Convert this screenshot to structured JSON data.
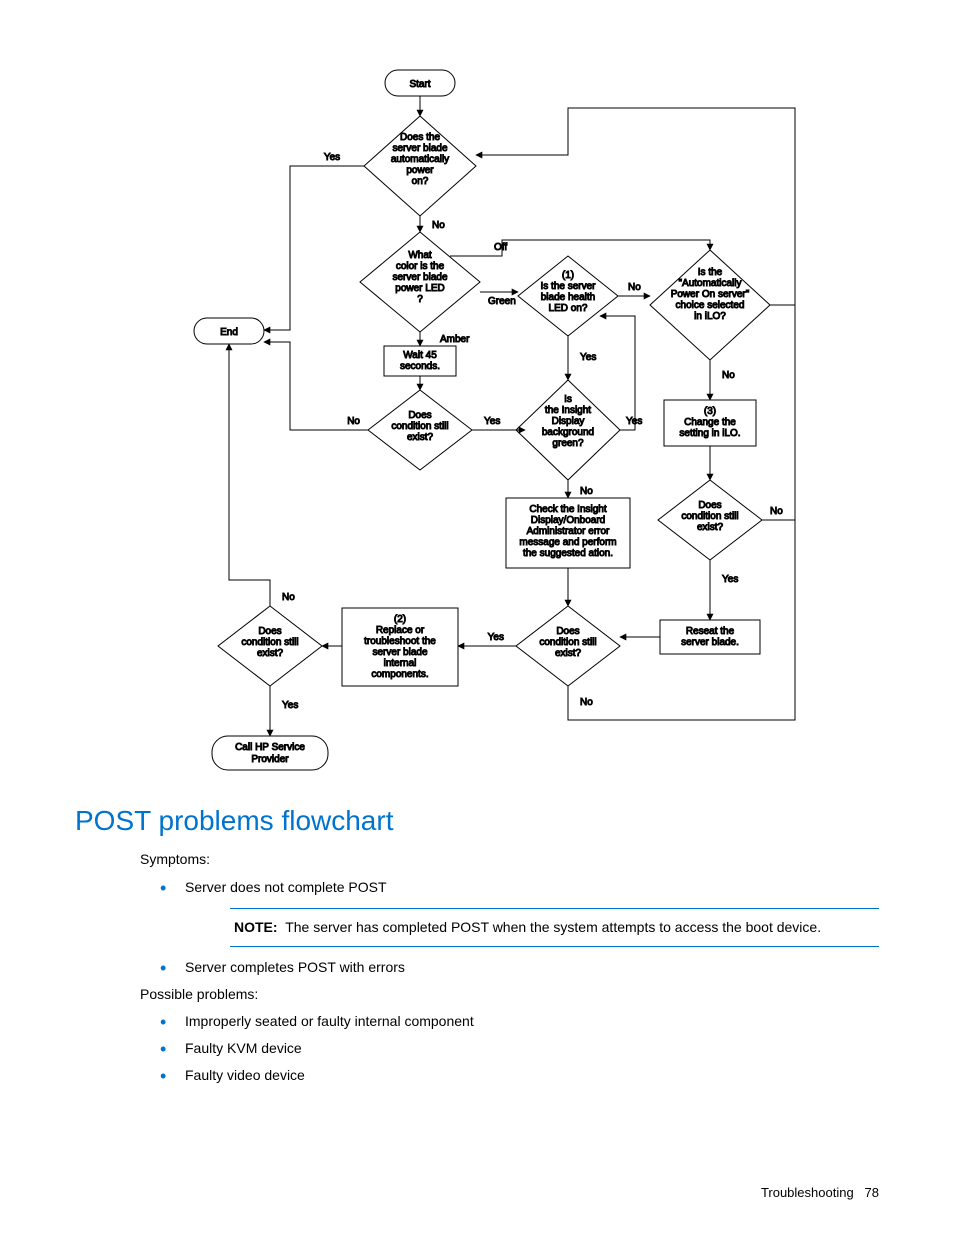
{
  "chart_data": {
    "type": "flowchart",
    "nodes": [
      {
        "id": "start",
        "kind": "terminator",
        "text": "Start"
      },
      {
        "id": "d1",
        "kind": "decision",
        "text": "Does the server blade automatically power on?"
      },
      {
        "id": "d2",
        "kind": "decision",
        "text": "What color is the server blade power LED ?"
      },
      {
        "id": "p_wait",
        "kind": "process",
        "text": "Wait 45 seconds."
      },
      {
        "id": "d_cond1",
        "kind": "decision",
        "text": "Does condition still exist?"
      },
      {
        "id": "end",
        "kind": "terminator",
        "text": "End"
      },
      {
        "id": "d_health",
        "kind": "decision",
        "text": "(1) Is the server blade health LED on?"
      },
      {
        "id": "d_ilo",
        "kind": "decision",
        "text": "Is the \"Automatically Power On server\" choice selected in iLO?"
      },
      {
        "id": "p_change",
        "kind": "process",
        "text": "(3) Change the setting in iLO."
      },
      {
        "id": "d_insight",
        "kind": "decision",
        "text": "Is the Insight Display background green?"
      },
      {
        "id": "p_check",
        "kind": "process",
        "text": "Check the Insight Display/Onboard Administrator error message and perform the suggested ation."
      },
      {
        "id": "d_cond_right",
        "kind": "decision",
        "text": "Does condition still exist?"
      },
      {
        "id": "p_reseat",
        "kind": "process",
        "text": "Reseat the server blade."
      },
      {
        "id": "d_cond_mid",
        "kind": "decision",
        "text": "Does condition still exist?"
      },
      {
        "id": "p_replace",
        "kind": "process",
        "text": "(2) Replace or troubleshoot the server blade internal components."
      },
      {
        "id": "d_cond_left",
        "kind": "decision",
        "text": "Does condition still exist?"
      },
      {
        "id": "p_call",
        "kind": "terminator",
        "text": "Call HP Service Provider"
      }
    ],
    "edges": [
      {
        "from": "start",
        "to": "d1"
      },
      {
        "from": "d1",
        "to": "end",
        "label": "Yes"
      },
      {
        "from": "d1",
        "to": "d2",
        "label": "No"
      },
      {
        "from": "d2",
        "to": "d_health",
        "label": "Green"
      },
      {
        "from": "d2",
        "to": "p_wait",
        "label": "Amber"
      },
      {
        "from": "d2",
        "label": "Off",
        "to": "d_ilo"
      },
      {
        "from": "p_wait",
        "to": "d_cond1"
      },
      {
        "from": "d_cond1",
        "to": "end",
        "label": "No"
      },
      {
        "from": "d_cond1",
        "to": "d_insight",
        "label": "Yes"
      },
      {
        "from": "d_health",
        "to": "d_ilo",
        "label": "No"
      },
      {
        "from": "d_health",
        "to": "d_insight",
        "label": "Yes"
      },
      {
        "from": "d_ilo",
        "to": "p_change",
        "label": "No"
      },
      {
        "from": "d_ilo",
        "label": "Yes",
        "to": "d1"
      },
      {
        "from": "p_change",
        "to": "d_cond_right"
      },
      {
        "from": "d_cond_right",
        "to": "p_reseat",
        "label": "Yes"
      },
      {
        "from": "d_cond_right",
        "label": "No",
        "to": "d1"
      },
      {
        "from": "d_insight",
        "to": "p_check",
        "label": "No"
      },
      {
        "from": "d_insight",
        "label": "Yes",
        "to": "d_health"
      },
      {
        "from": "p_check",
        "to": "d_cond_mid"
      },
      {
        "from": "p_reseat",
        "to": "d_cond_mid"
      },
      {
        "from": "d_cond_mid",
        "to": "p_replace",
        "label": "Yes"
      },
      {
        "from": "d_cond_mid",
        "label": "No",
        "to": "d1"
      },
      {
        "from": "p_replace",
        "to": "d_cond_left"
      },
      {
        "from": "d_cond_left",
        "label": "No",
        "to": "end"
      },
      {
        "from": "d_cond_left",
        "to": "p_call",
        "label": "Yes"
      }
    ]
  },
  "flow_labels": {
    "yes": "Yes",
    "no": "No",
    "off": "Off",
    "green": "Green",
    "amber": "Amber"
  },
  "flow_nodes": {
    "start": "Start",
    "d1": [
      "Does the",
      "server blade",
      "automatically",
      "power",
      "on?"
    ],
    "d2": [
      "What",
      "color is the",
      "server blade",
      "power LED",
      "?"
    ],
    "wait": [
      "Wait 45",
      "seconds."
    ],
    "cond": [
      "Does",
      "condition still",
      "exist?"
    ],
    "end": "End",
    "health": [
      "(1)",
      "Is the server",
      "blade health",
      "LED on?"
    ],
    "ilo": [
      "Is the",
      "\"Automatically",
      "Power On server\"",
      "choice selected",
      "in iLO?"
    ],
    "change": [
      "(3)",
      "Change the",
      "setting in iLO."
    ],
    "insight": [
      "Is",
      "the Insight",
      "Display",
      "background",
      "green?"
    ],
    "check": [
      "Check the Insight",
      "Display/Onboard",
      "Administrator error",
      "message and perform",
      "the suggested ation."
    ],
    "reseat": [
      "Reseat the",
      "server blade."
    ],
    "cond_mid": [
      "Does",
      "condition still",
      "exist?"
    ],
    "replace": [
      "(2)",
      "Replace or",
      "troubleshoot the",
      "server blade",
      "internal",
      "components."
    ],
    "cond_left": [
      "Does",
      "condition still",
      "exist?"
    ],
    "call": [
      "Call HP Service",
      "Provider"
    ]
  },
  "section_title": "POST problems flowchart",
  "symptoms_label": "Symptoms:",
  "symptom_items": [
    "Server does not complete POST",
    "Server completes POST with errors"
  ],
  "note": {
    "label": "NOTE:",
    "text": "The server has completed POST when the system attempts to access the boot device."
  },
  "possible_label": "Possible problems:",
  "possible_items": [
    "Improperly seated or faulty internal component",
    "Faulty KVM device",
    "Faulty video device"
  ],
  "footer": {
    "section": "Troubleshooting",
    "page": "78"
  }
}
